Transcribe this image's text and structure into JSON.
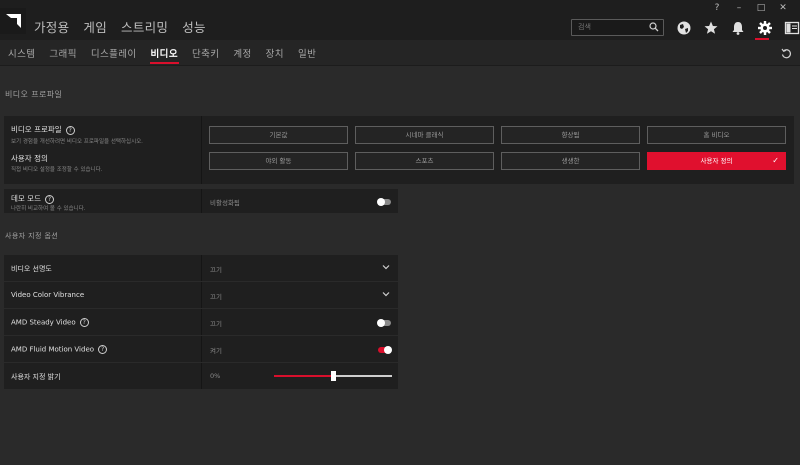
{
  "topnav": {
    "items": [
      "가정용",
      "게임",
      "스트리밍",
      "성능"
    ]
  },
  "window_controls": [
    "?",
    "–",
    "□",
    "✕"
  ],
  "search": {
    "placeholder": "검색"
  },
  "top_icons": [
    "globe-icon",
    "star-icon",
    "bell-icon",
    "gear-icon",
    "sidebar-icon"
  ],
  "subnav": {
    "items": [
      "시스템",
      "그래픽",
      "디스플레이",
      "비디오",
      "단축키",
      "계정",
      "장치",
      "일반"
    ],
    "active": "비디오"
  },
  "video_profile_section": {
    "title": "비디오 프로파일"
  },
  "profile_panel": {
    "label": "비디오 프로파일",
    "description": "보기 경험을 개선하려면 비디오 프로파일을 선택하십시오.",
    "custom_label": "사용자 정의",
    "custom_description": "직접 비디오 설정을 조정할 수 있습니다.",
    "presets": [
      "기본값",
      "시네마 클래식",
      "향상됨",
      "홈 비디오",
      "야외 활동",
      "스포츠",
      "생생한",
      "사용자 정의"
    ],
    "selected": "사용자 정의"
  },
  "demo_mode": {
    "label": "데모 모드",
    "description": "나란히 비교하여 볼 수 있습니다.",
    "value": "비활성화됨",
    "enabled": false
  },
  "custom_options_section": {
    "title": "사용자 지정 옵션"
  },
  "settings_rows": [
    {
      "name": "비디오 선명도",
      "value": "끄기",
      "control": "dropdown"
    },
    {
      "name": "Video Color Vibrance",
      "value": "끄기",
      "control": "dropdown"
    },
    {
      "name": "AMD Steady Video",
      "value": "끄기",
      "control": "toggle",
      "enabled": false,
      "help": true
    },
    {
      "name": "AMD Fluid Motion Video",
      "value": "켜기",
      "control": "toggle",
      "enabled": true,
      "help": true
    },
    {
      "name": "사용자 지정 밝기",
      "value": "0%",
      "control": "slider",
      "slider_level": 0.5
    }
  ],
  "colors": {
    "accent": "#d90f2c",
    "background": "#2a2a2a",
    "panel": "#1f1f1f"
  }
}
